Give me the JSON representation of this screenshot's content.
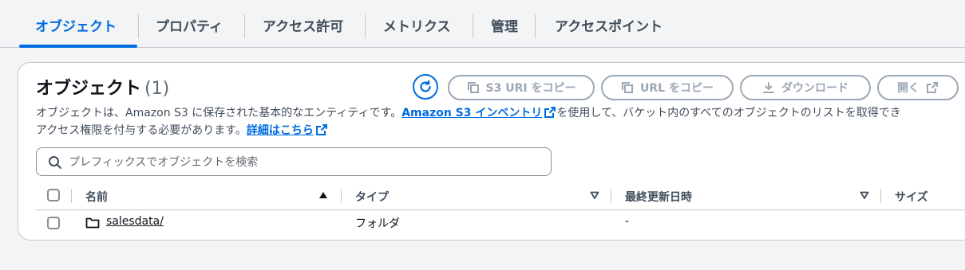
{
  "tabs": [
    {
      "label": "オブジェクト",
      "active": true
    },
    {
      "label": "プロパティ"
    },
    {
      "label": "アクセス許可"
    },
    {
      "label": "メトリクス"
    },
    {
      "label": "管理"
    },
    {
      "label": "アクセスポイント"
    }
  ],
  "panel": {
    "title": "オブジェクト",
    "count": "(1)",
    "description_1": "オブジェクトは、Amazon S3 に保存された基本的なエンティティです。",
    "inventory_link": "Amazon S3 インベントリ",
    "description_2": "を使用して、バケット内のすべてのオブジェクトのリストを取得でき",
    "description_3": "アクセス権限を付与する必要があります。",
    "learn_more_link": "詳細はこちら"
  },
  "toolbar": {
    "copy_s3_uri": "S3 URI をコピー",
    "copy_url": "URL をコピー",
    "download": "ダウンロード",
    "open": "開く"
  },
  "search": {
    "placeholder": "プレフィックスでオブジェクトを検索",
    "value": ""
  },
  "table": {
    "columns": [
      "名前",
      "タイプ",
      "最終更新日時",
      "サイズ"
    ],
    "rows": [
      {
        "name": "salesdata/",
        "type": "フォルダ",
        "modified": "-",
        "size": ""
      }
    ]
  },
  "colors": {
    "accent": "#006ce0",
    "disabled": "#9ba7b6",
    "border": "#c6c6cd"
  }
}
